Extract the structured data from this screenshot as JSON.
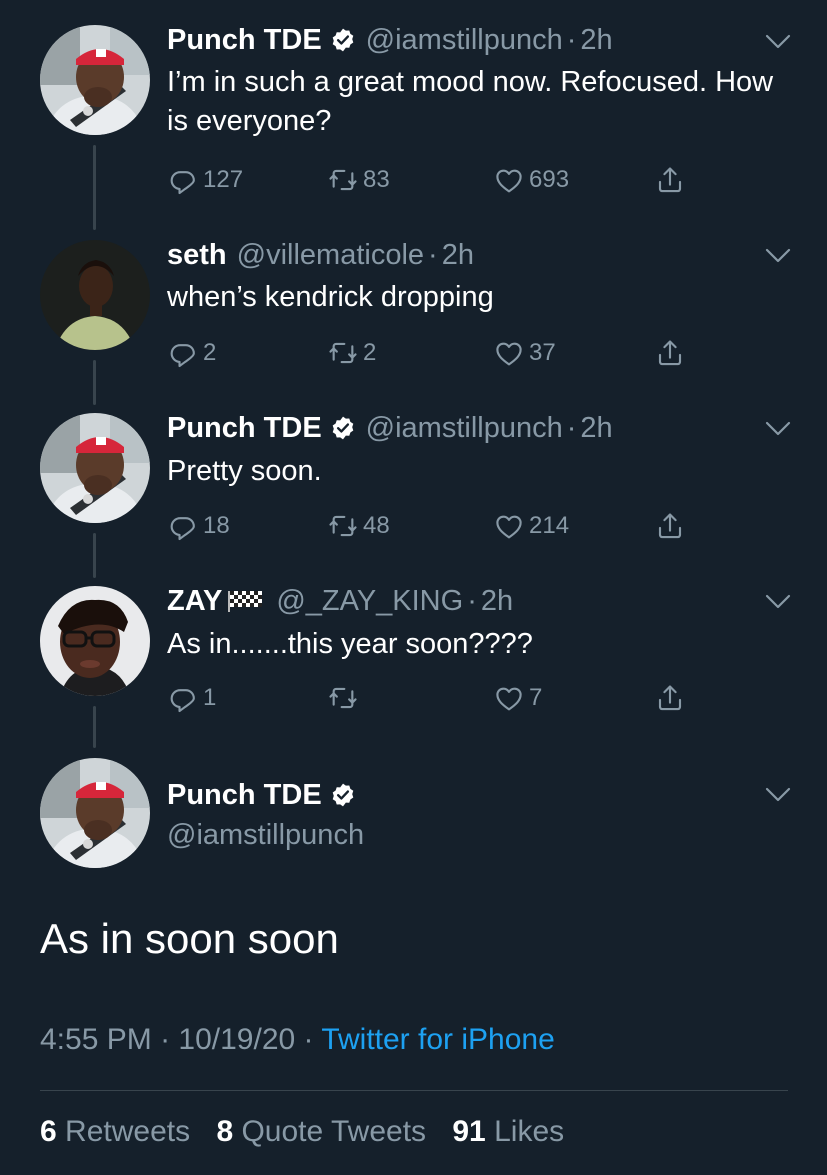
{
  "colors": {
    "background": "#15202b",
    "secondary_text": "#8899a6",
    "link": "#1da1f2",
    "verified": "#ffffff",
    "divider": "#38444d"
  },
  "tweets": [
    {
      "name": "Punch TDE",
      "verified": true,
      "handle": "@iamstillpunch",
      "time": "2h",
      "text": "I’m in such a great mood now. Refocused. How is everyone?",
      "replies": "127",
      "retweets": "83",
      "likes": "693"
    },
    {
      "name": "seth",
      "verified": false,
      "handle": "@villematicole",
      "time": "2h",
      "text": "when’s kendrick dropping",
      "replies": "2",
      "retweets": "2",
      "likes": "37"
    },
    {
      "name": "Punch TDE",
      "verified": true,
      "handle": "@iamstillpunch",
      "time": "2h",
      "text": "Pretty soon.",
      "replies": "18",
      "retweets": "48",
      "likes": "214"
    },
    {
      "name": "ZAY",
      "name_emoji": "checkered-flag-icon",
      "verified": false,
      "handle": "@_ZAY_KING",
      "time": "2h",
      "text": "As in.......this year soon????",
      "replies": "1",
      "retweets": "",
      "likes": "7"
    }
  ],
  "main_tweet": {
    "name": "Punch TDE",
    "verified": true,
    "handle": "@iamstillpunch",
    "text": "As in soon soon",
    "time": "4:55 PM",
    "date": "10/19/20",
    "source": "Twitter for iPhone",
    "retweets_count": "6",
    "retweets_label": "Retweets",
    "quotes_count": "8",
    "quotes_label": "Quote Tweets",
    "likes_count": "91",
    "likes_label": "Likes"
  }
}
